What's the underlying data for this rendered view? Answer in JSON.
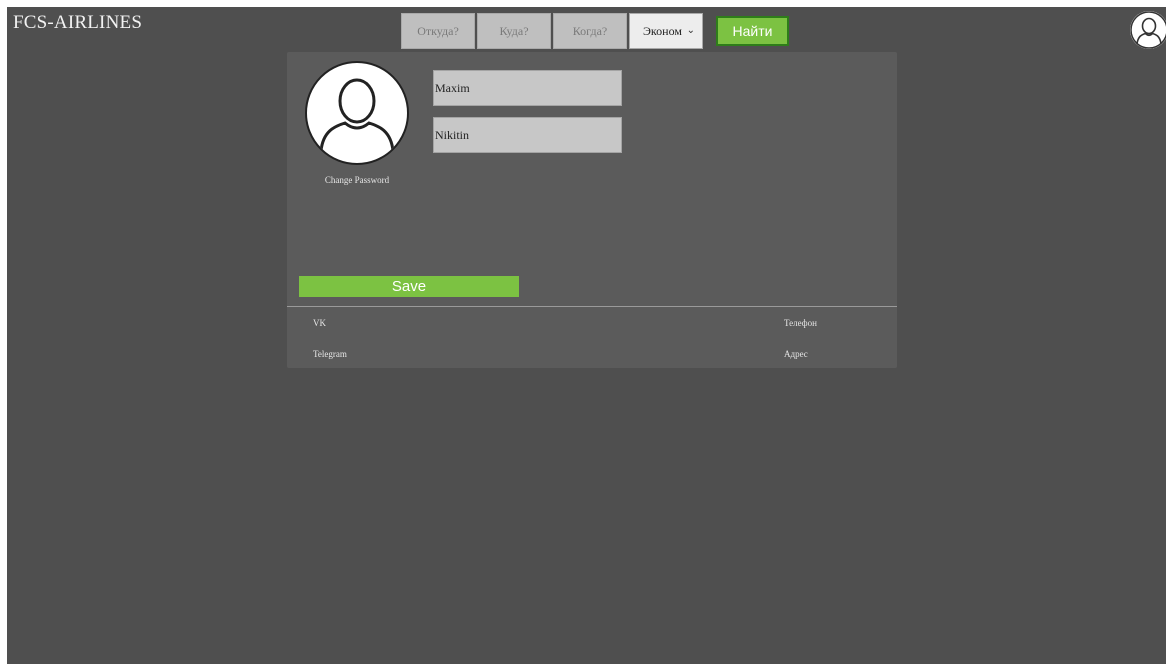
{
  "header": {
    "brand": "FCS-AIRLINES"
  },
  "search": {
    "from_placeholder": "Откуда?",
    "to_placeholder": "Куда?",
    "when_placeholder": "Когда?",
    "class_selected": "Эконом",
    "find_label": "Найти"
  },
  "profile": {
    "change_password_label": "Change Password",
    "first_name": "Maxim",
    "last_name": "Nikitin",
    "save_label": "Save"
  },
  "contacts": {
    "vk_label": "VK",
    "telegram_label": "Telegram",
    "phone_label": "Телефон",
    "address_label": "Адрес"
  },
  "colors": {
    "background": "#4f4f4f",
    "card": "#5b5b5b",
    "accent_green": "#7cc242"
  },
  "icons": {
    "top_avatar": "user-avatar-icon",
    "profile_avatar": "user-avatar-icon",
    "select_chevron": "chevron-down-icon"
  }
}
